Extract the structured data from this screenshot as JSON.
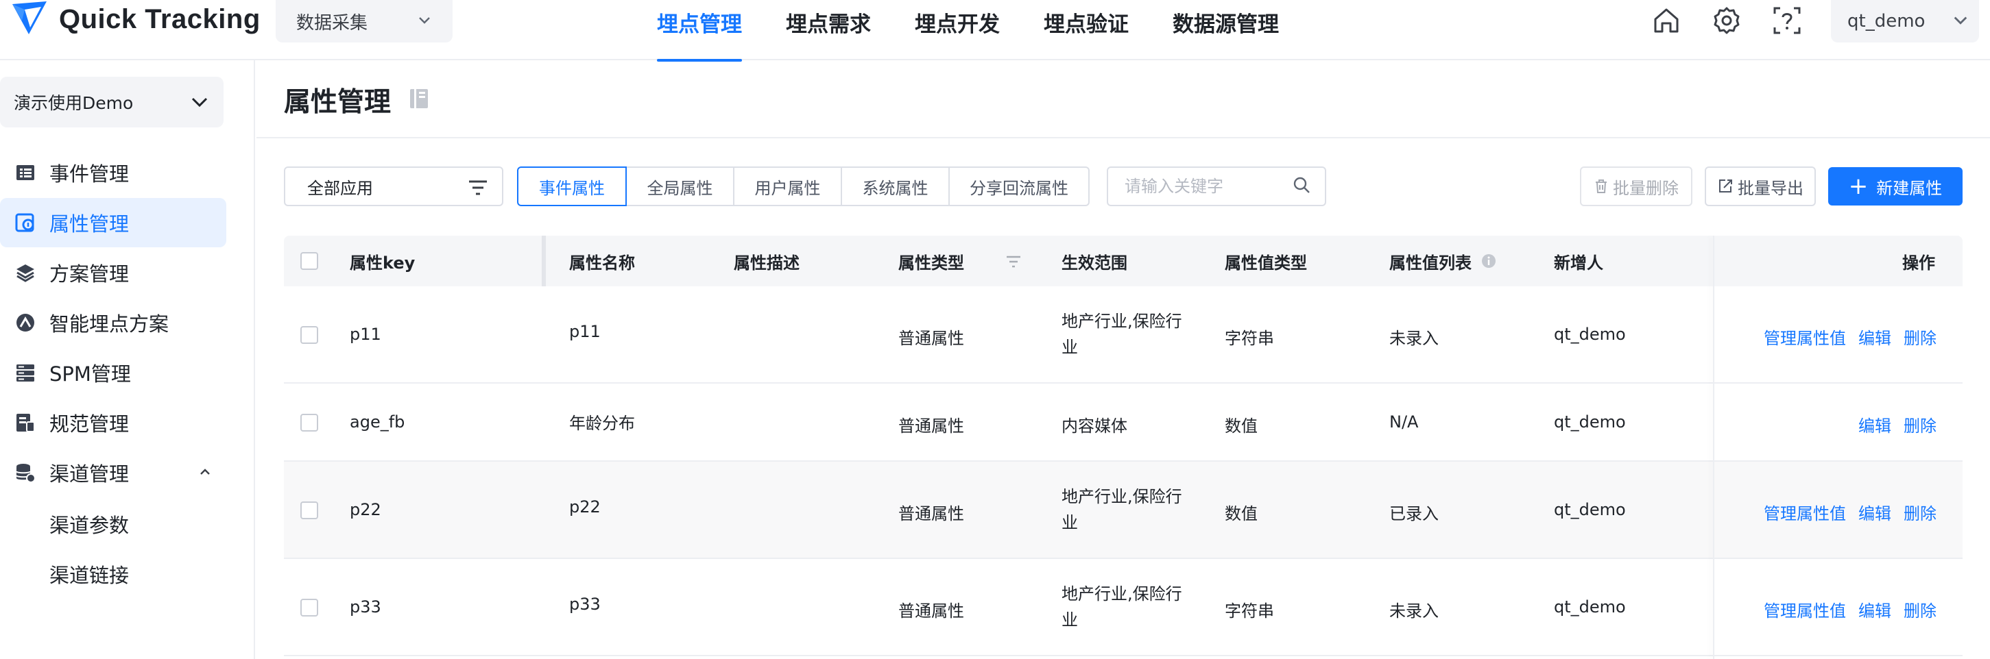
{
  "app": {
    "name": "Quick Tracking",
    "module": "数据采集",
    "nav": [
      "埋点管理",
      "埋点需求",
      "埋点开发",
      "埋点验证",
      "数据源管理"
    ],
    "active_nav": 0,
    "user": "qt_demo",
    "icons": [
      "home-icon",
      "gear-icon",
      "help-icon"
    ]
  },
  "sidebar": {
    "project": "演示使用Demo",
    "items": [
      {
        "label": "事件管理",
        "icon": "event-list-icon"
      },
      {
        "label": "属性管理",
        "icon": "property-icon",
        "active": true
      },
      {
        "label": "方案管理",
        "icon": "layers-icon"
      },
      {
        "label": "智能埋点方案",
        "icon": "smart-plan-icon"
      },
      {
        "label": "SPM管理",
        "icon": "server-icon"
      },
      {
        "label": "规范管理",
        "icon": "spec-doc-icon"
      },
      {
        "label": "渠道管理",
        "icon": "channel-icon",
        "expanded": true
      }
    ],
    "subitems": [
      "渠道参数",
      "渠道链接"
    ]
  },
  "page": {
    "title": "属性管理",
    "app_filter": "全部应用",
    "tabs": [
      "事件属性",
      "全局属性",
      "用户属性",
      "系统属性",
      "分享回流属性"
    ],
    "active_tab": 0,
    "search_placeholder": "请输入关键字",
    "batch_delete": "批量删除",
    "batch_export": "批量导出",
    "create": "新建属性"
  },
  "table": {
    "columns": [
      "属性key",
      "属性名称",
      "属性描述",
      "属性类型",
      "生效范围",
      "属性值类型",
      "属性值列表",
      "新增人",
      "操作"
    ],
    "rows": [
      {
        "key": "p11",
        "name": "p11",
        "desc": "",
        "type": "普通属性",
        "scope": "地产行业,保险行业",
        "value_type": "字符串",
        "value_list": "未录入",
        "creator": "qt_demo",
        "ops": [
          "管理属性值",
          "编辑",
          "删除"
        ]
      },
      {
        "key": "age_fb",
        "name": "年龄分布",
        "desc": "",
        "type": "普通属性",
        "scope": "内容媒体",
        "value_type": "数值",
        "value_list": "N/A",
        "creator": "qt_demo",
        "ops": [
          "编辑",
          "删除"
        ]
      },
      {
        "key": "p22",
        "name": "p22",
        "desc": "",
        "type": "普通属性",
        "scope": "地产行业,保险行业",
        "value_type": "数值",
        "value_list": "已录入",
        "creator": "qt_demo",
        "ops": [
          "管理属性值",
          "编辑",
          "删除"
        ]
      },
      {
        "key": "p33",
        "name": "p33",
        "desc": "",
        "type": "普通属性",
        "scope": "地产行业,保险行业",
        "value_type": "字符串",
        "value_list": "未录入",
        "creator": "qt_demo",
        "ops": [
          "管理属性值",
          "编辑",
          "删除"
        ]
      }
    ]
  },
  "colors": {
    "primary": "#1677ff",
    "active_bg": "#e8f1ff",
    "border": "#dcdfe6"
  }
}
